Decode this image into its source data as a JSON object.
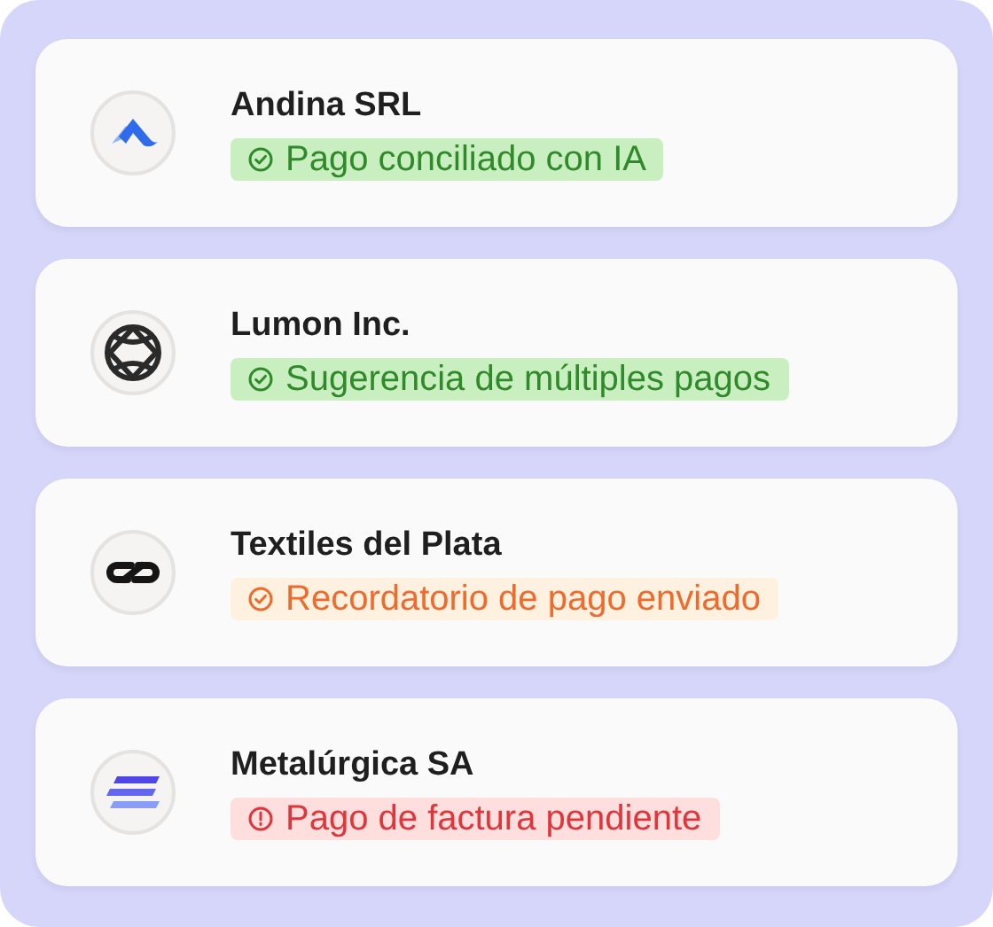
{
  "companies": [
    {
      "name": "Andina SRL",
      "logo": {
        "kind": "peak"
      },
      "status": {
        "kind": "success",
        "text": "Pago conciliado con IA"
      }
    },
    {
      "name": "Lumon Inc.",
      "logo": {
        "kind": "globe"
      },
      "status": {
        "kind": "success",
        "text": "Sugerencia de múltiples pagos"
      }
    },
    {
      "name": "Textiles del Plata",
      "logo": {
        "kind": "link"
      },
      "status": {
        "kind": "warning",
        "text": "Recordatorio de pago enviado"
      }
    },
    {
      "name": "Metalúrgica SA",
      "logo": {
        "kind": "waves"
      },
      "status": {
        "kind": "error",
        "text": "Pago de factura pendiente"
      }
    }
  ]
}
